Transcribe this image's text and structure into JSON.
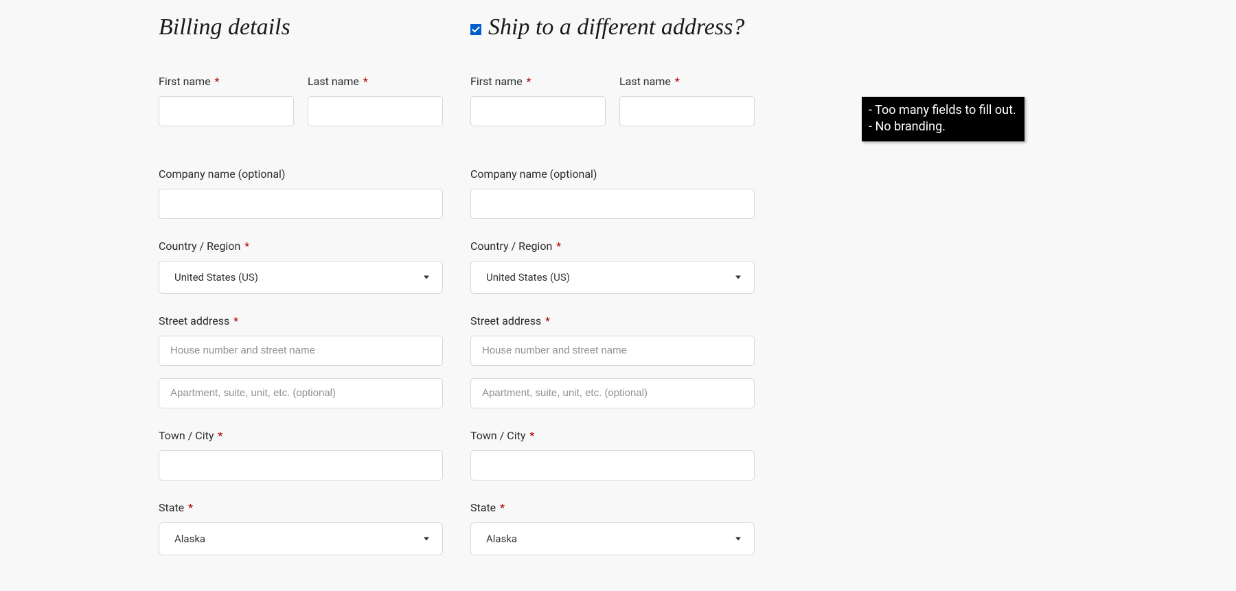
{
  "billing": {
    "title": "Billing details",
    "first_name_label": "First name",
    "last_name_label": "Last name",
    "company_label": "Company name (optional)",
    "country_label": "Country / Region",
    "country_value": "United States (US)",
    "street_label": "Street address",
    "street1_placeholder": "House number and street name",
    "street2_placeholder": "Apartment, suite, unit, etc. (optional)",
    "city_label": "Town / City",
    "state_label": "State",
    "state_value": "Alaska"
  },
  "shipping": {
    "title": "Ship to a different address?",
    "checked": true,
    "first_name_label": "First name",
    "last_name_label": "Last name",
    "company_label": "Company name (optional)",
    "country_label": "Country / Region",
    "country_value": "United States (US)",
    "street_label": "Street address",
    "street1_placeholder": "House number and street name",
    "street2_placeholder": "Apartment, suite, unit, etc. (optional)",
    "city_label": "Town / City",
    "state_label": "State",
    "state_value": "Alaska"
  },
  "required_marker": "*",
  "annotation": {
    "line1": "- Too many fields to fill out.",
    "line2": "- No branding."
  }
}
